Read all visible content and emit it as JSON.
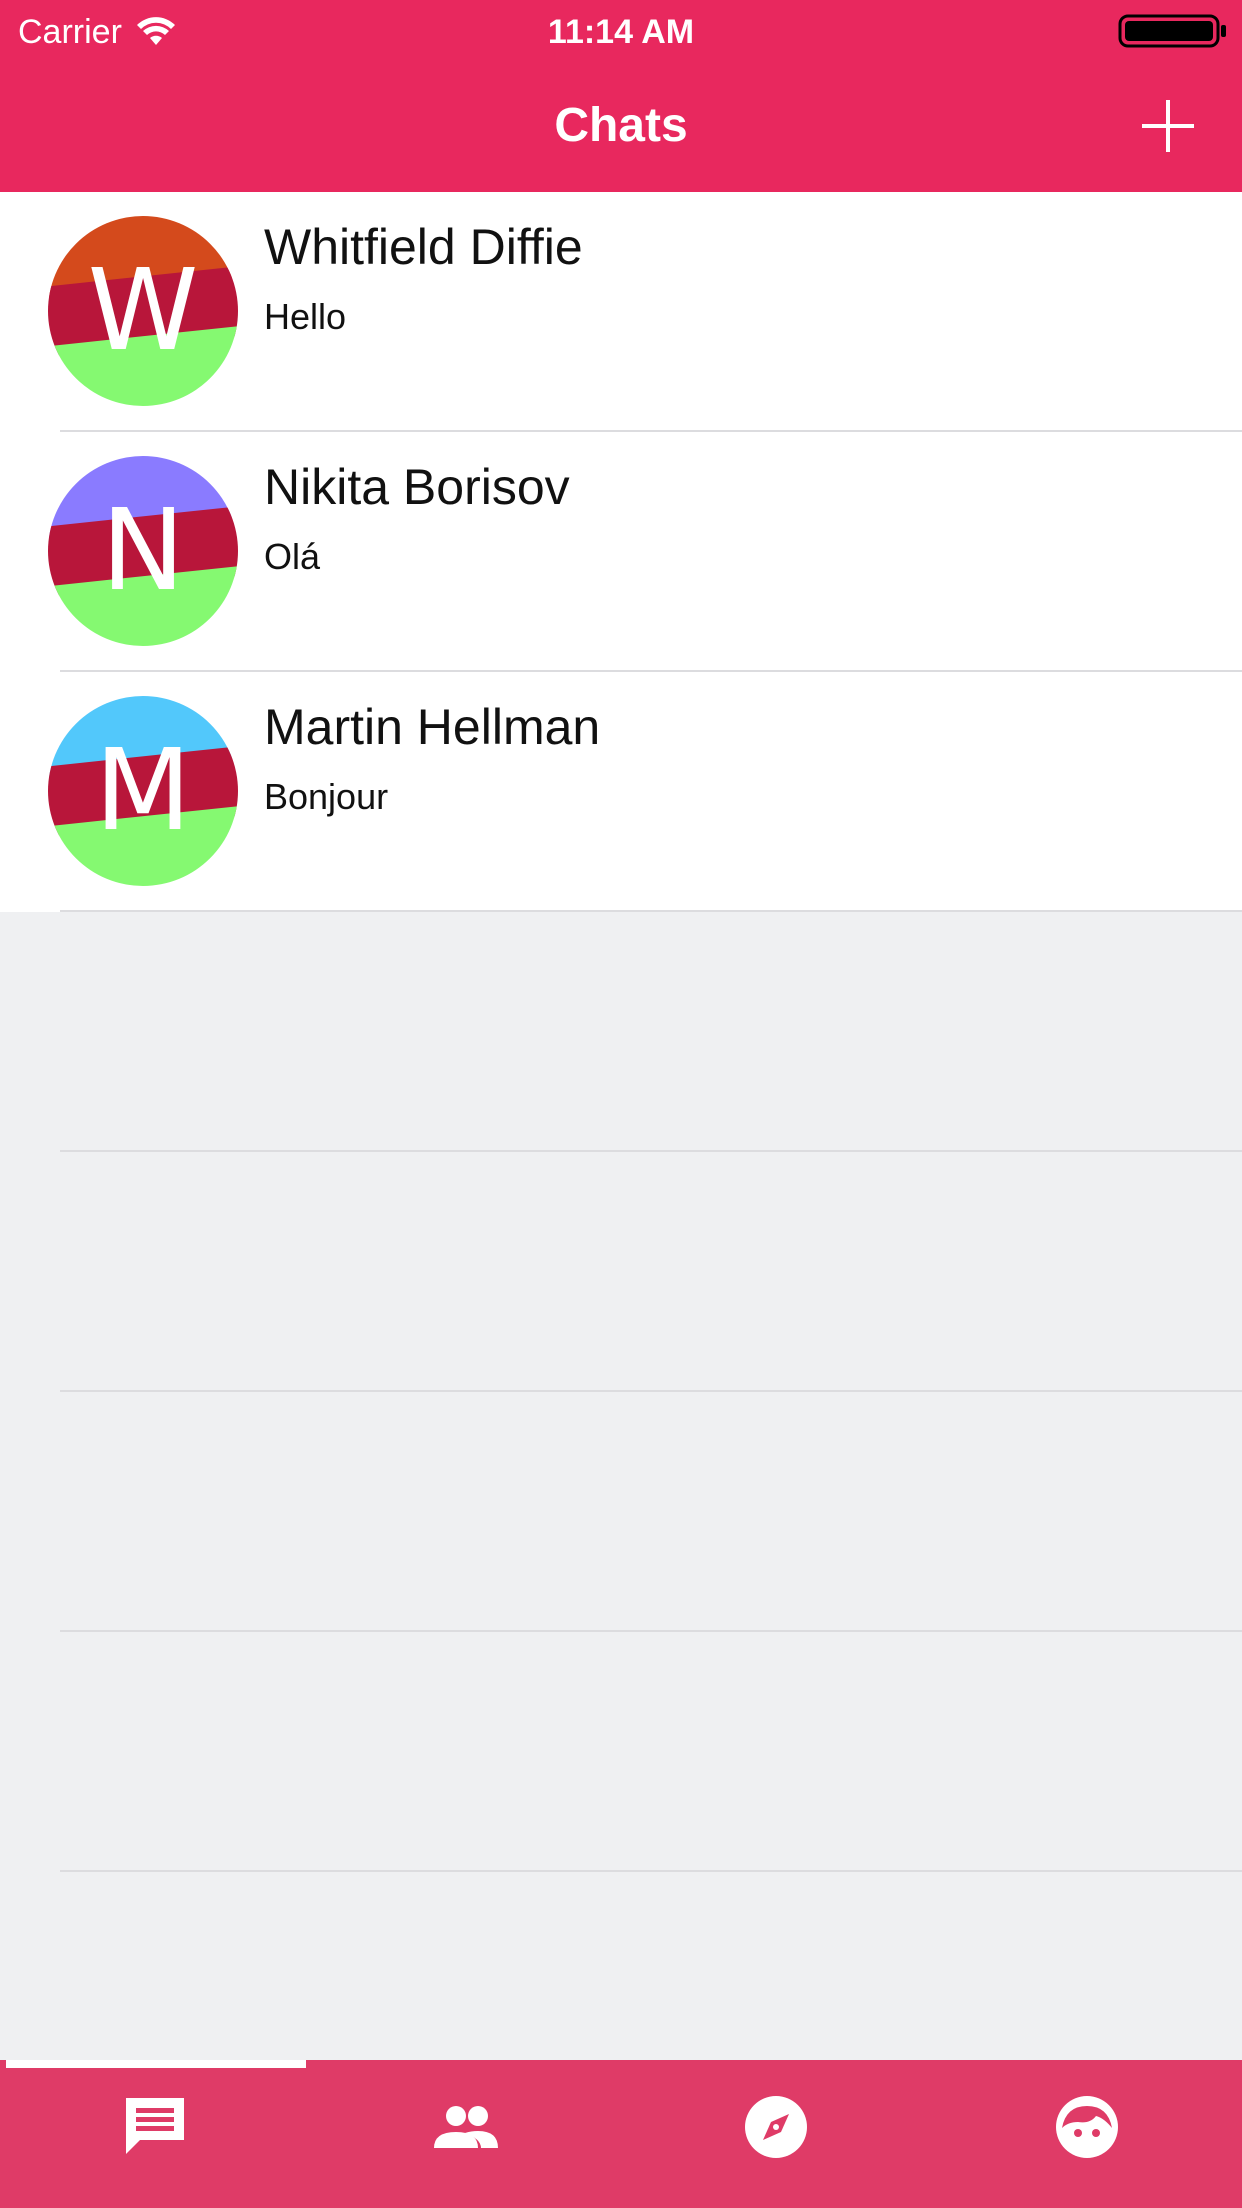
{
  "status_bar": {
    "carrier": "Carrier",
    "time": "11:14 AM"
  },
  "nav": {
    "title": "Chats",
    "add_icon": "plus-icon"
  },
  "chats": [
    {
      "name": "Whitfield Diffie",
      "message": "Hello",
      "initial": "W",
      "avatar_colors": [
        "#d44a1c",
        "#b8163a",
        "#85f971"
      ]
    },
    {
      "name": "Nikita Borisov",
      "message": "Olá",
      "initial": "N",
      "avatar_colors": [
        "#8a7bff",
        "#b8163a",
        "#85f971"
      ]
    },
    {
      "name": "Martin Hellman",
      "message": "Bonjour",
      "initial": "M",
      "avatar_colors": [
        "#52c8fb",
        "#b8163a",
        "#85f971"
      ]
    }
  ],
  "tabs": [
    {
      "icon": "chat-bubble-icon",
      "selected": true
    },
    {
      "icon": "people-icon",
      "selected": false
    },
    {
      "icon": "compass-icon",
      "selected": false
    },
    {
      "icon": "face-icon",
      "selected": false
    }
  ],
  "colors": {
    "header": "#e8285e",
    "tabbar": "#df3b67",
    "background": "#eff0f2"
  }
}
